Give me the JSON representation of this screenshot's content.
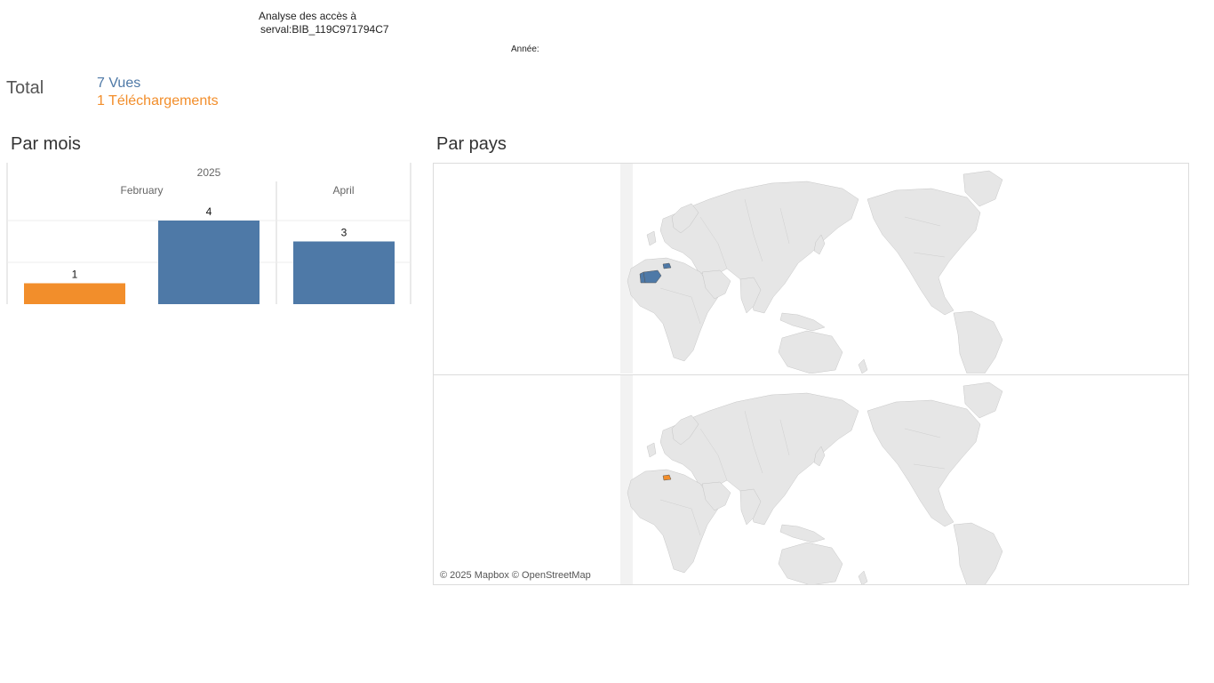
{
  "header": {
    "title_line1": "Analyse des accès à",
    "title_line2": "serval:BIB_119C971794C7",
    "year_filter_label": "Année:"
  },
  "totals": {
    "label": "Total",
    "views": "7 Vues",
    "downloads": "1 Téléchargements"
  },
  "colors": {
    "views": "#4e79a7",
    "downloads": "#f28e2b",
    "land": "#e6e6e6",
    "border": "#bbbbbb"
  },
  "sections": {
    "by_month": "Par mois",
    "by_country": "Par pays"
  },
  "chart_data": {
    "type": "bar",
    "year": "2025",
    "categories": [
      "February",
      "April"
    ],
    "series": [
      {
        "name": "Téléchargements",
        "values": [
          1,
          null
        ]
      },
      {
        "name": "Vues",
        "values": [
          4,
          3
        ]
      }
    ],
    "ylim": [
      0,
      5
    ],
    "grid": true
  },
  "map": {
    "attribution": "© 2025 Mapbox © OpenStreetMap",
    "views_countries": [
      "Spain",
      "Switzerland",
      "Portugal"
    ],
    "downloads_countries": [
      "Switzerland"
    ]
  }
}
